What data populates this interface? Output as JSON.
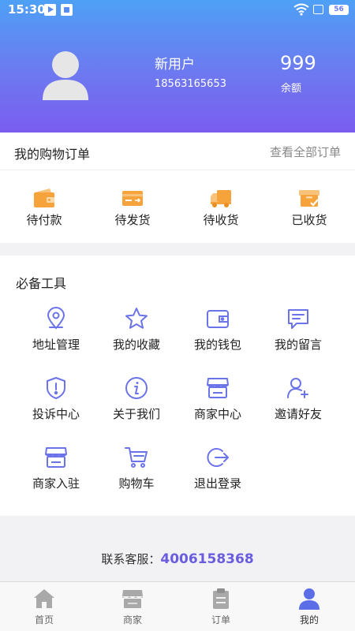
{
  "status_bar": {
    "time": "15:30",
    "battery": "56"
  },
  "profile": {
    "username": "新用户",
    "phone": "18563165653",
    "balance_value": "999",
    "balance_label": "余额"
  },
  "orders": {
    "title": "我的购物订单",
    "view_all": "查看全部订单",
    "items": [
      {
        "label": "待付款",
        "icon": "wallet-icon"
      },
      {
        "label": "待发货",
        "icon": "card-icon"
      },
      {
        "label": "待收货",
        "icon": "truck-icon"
      },
      {
        "label": "已收货",
        "icon": "box-check-icon"
      }
    ]
  },
  "tools": {
    "title": "必备工具",
    "items": [
      {
        "label": "地址管理",
        "icon": "location-icon"
      },
      {
        "label": "我的收藏",
        "icon": "star-icon"
      },
      {
        "label": "我的钱包",
        "icon": "wallet-icon"
      },
      {
        "label": "我的留言",
        "icon": "message-icon"
      },
      {
        "label": "投诉中心",
        "icon": "shield-icon"
      },
      {
        "label": "关于我们",
        "icon": "info-icon"
      },
      {
        "label": "商家中心",
        "icon": "store-icon"
      },
      {
        "label": "邀请好友",
        "icon": "add-user-icon"
      },
      {
        "label": "商家入驻",
        "icon": "store-icon"
      },
      {
        "label": "购物车",
        "icon": "cart-icon"
      },
      {
        "label": "退出登录",
        "icon": "logout-icon"
      }
    ]
  },
  "contact": {
    "label": "联系客服：",
    "phone": "4006158368"
  },
  "tabbar": {
    "tabs": [
      {
        "label": "首页",
        "icon": "home-icon"
      },
      {
        "label": "商家",
        "icon": "store-icon"
      },
      {
        "label": "订单",
        "icon": "clipboard-icon"
      },
      {
        "label": "我的",
        "icon": "user-icon"
      }
    ],
    "active_index": 3
  },
  "colors": {
    "header_top": "#4ea0f6",
    "header_bottom": "#7a5df0",
    "order_icon": "#f7a33c",
    "tool_icon": "#6b73e8",
    "tab_active": "#5b6ee8",
    "tab_inactive": "#a9a9a9",
    "contact_phone": "#6a5cde"
  }
}
